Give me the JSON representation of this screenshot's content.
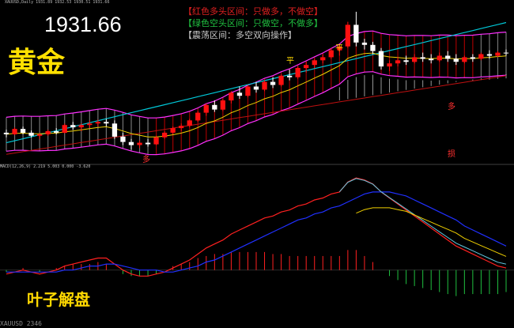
{
  "header": {
    "info": "XAUUSD,Daily  1931.89 1932.53 1930.51 1931.66"
  },
  "price_label": "1931.66",
  "instrument_label": "黄金",
  "legend": {
    "line1": "【红色多头区间：只做多，不做空】",
    "line2": "【绿色空头区间：只做空，不做多】",
    "line3": "【震荡区间：多空双向操作】"
  },
  "annotations": {
    "ping1": "平",
    "ping2": "平",
    "duo1": "多",
    "duo2": "多",
    "sun": "损"
  },
  "macd_label": "MACD(12,26,9) 2.219 5.003 0.000 -3.620",
  "brand": "叶子解盘",
  "status": "XAUUSD 2346",
  "colors": {
    "bull": "#ff1010",
    "bear": "#ffffff",
    "band_fill": "#b00000",
    "band_edge": "#ff30ff",
    "cyan": "#00c8d8",
    "yellow": "#f0d000",
    "macd_fast": "#ff2020",
    "macd_slow": "#2030ff"
  },
  "chart_data": [
    {
      "type": "candlestick",
      "title": "",
      "series": [
        {
          "values": [
            [
              1828,
              1832,
              1822,
              1826
            ],
            [
              1826,
              1835,
              1825,
              1833
            ],
            [
              1833,
              1836,
              1826,
              1828
            ],
            [
              1828,
              1831,
              1822,
              1824
            ],
            [
              1824,
              1828,
              1820,
              1826
            ],
            [
              1826,
              1832,
              1824,
              1830
            ],
            [
              1830,
              1834,
              1826,
              1828
            ],
            [
              1828,
              1840,
              1827,
              1838
            ],
            [
              1838,
              1842,
              1832,
              1835
            ],
            [
              1835,
              1840,
              1830,
              1838
            ],
            [
              1838,
              1844,
              1834,
              1840
            ],
            [
              1840,
              1845,
              1836,
              1842
            ],
            [
              1842,
              1846,
              1836,
              1840
            ],
            [
              1840,
              1844,
              1820,
              1823
            ],
            [
              1823,
              1828,
              1812,
              1816
            ],
            [
              1816,
              1820,
              1806,
              1812
            ],
            [
              1812,
              1818,
              1808,
              1815
            ],
            [
              1815,
              1820,
              1810,
              1813
            ],
            [
              1813,
              1824,
              1812,
              1822
            ],
            [
              1822,
              1830,
              1820,
              1828
            ],
            [
              1828,
              1836,
              1826,
              1834
            ],
            [
              1834,
              1840,
              1830,
              1837
            ],
            [
              1837,
              1846,
              1835,
              1844
            ],
            [
              1844,
              1856,
              1842,
              1854
            ],
            [
              1854,
              1866,
              1850,
              1864
            ],
            [
              1864,
              1870,
              1855,
              1858
            ],
            [
              1858,
              1872,
              1856,
              1870
            ],
            [
              1870,
              1882,
              1866,
              1880
            ],
            [
              1880,
              1888,
              1872,
              1876
            ],
            [
              1876,
              1890,
              1874,
              1888
            ],
            [
              1888,
              1894,
              1880,
              1884
            ],
            [
              1884,
              1896,
              1882,
              1894
            ],
            [
              1894,
              1900,
              1886,
              1890
            ],
            [
              1890,
              1904,
              1888,
              1902
            ],
            [
              1902,
              1910,
              1896,
              1900
            ],
            [
              1900,
              1914,
              1898,
              1912
            ],
            [
              1912,
              1920,
              1906,
              1916
            ],
            [
              1916,
              1924,
              1912,
              1922
            ],
            [
              1922,
              1930,
              1918,
              1926
            ],
            [
              1926,
              1938,
              1924,
              1935
            ],
            [
              1935,
              1942,
              1928,
              1940
            ],
            [
              1940,
              1972,
              1938,
              1968
            ],
            [
              1968,
              1985,
              1940,
              1945
            ],
            [
              1945,
              1950,
              1936,
              1942
            ],
            [
              1942,
              1946,
              1930,
              1934
            ],
            [
              1934,
              1938,
              1910,
              1914
            ],
            [
              1914,
              1922,
              1908,
              1918
            ],
            [
              1918,
              1926,
              1914,
              1922
            ],
            [
              1922,
              1928,
              1916,
              1920
            ],
            [
              1920,
              1930,
              1918,
              1926
            ],
            [
              1926,
              1932,
              1920,
              1924
            ],
            [
              1924,
              1930,
              1918,
              1922
            ],
            [
              1922,
              1932,
              1920,
              1928
            ],
            [
              1928,
              1934,
              1920,
              1924
            ],
            [
              1924,
              1930,
              1916,
              1920
            ],
            [
              1920,
              1928,
              1918,
              1926
            ],
            [
              1926,
              1930,
              1920,
              1924
            ],
            [
              1924,
              1932,
              1922,
              1930
            ],
            [
              1930,
              1935,
              1924,
              1928
            ],
            [
              1928,
              1934,
              1926,
              1932
            ],
            [
              1932,
              1936,
              1928,
              1931
            ]
          ]
        }
      ]
    },
    {
      "type": "line",
      "title": "",
      "series": [
        {
          "values": [
            -2,
            -1,
            0,
            -1,
            -2,
            -1,
            0,
            2,
            3,
            4,
            5,
            6,
            6,
            3,
            0,
            -2,
            -3,
            -3,
            -2,
            -1,
            1,
            3,
            5,
            8,
            11,
            13,
            15,
            18,
            20,
            22,
            24,
            26,
            27,
            29,
            30,
            32,
            33,
            35,
            36,
            38,
            39,
            44,
            46,
            45,
            43,
            39,
            36,
            33,
            30,
            27,
            24,
            21,
            18,
            15,
            12,
            10,
            8,
            6,
            4,
            2,
            1
          ]
        },
        {
          "values": [
            -1,
            -1,
            -1,
            -1,
            -1,
            -1,
            -1,
            0,
            0,
            1,
            2,
            2,
            3,
            3,
            2,
            1,
            0,
            0,
            0,
            -1,
            -1,
            0,
            1,
            2,
            4,
            5,
            7,
            9,
            11,
            13,
            15,
            17,
            19,
            21,
            23,
            25,
            26,
            28,
            29,
            31,
            32,
            34,
            36,
            38,
            39,
            39,
            39,
            38,
            37,
            35,
            33,
            31,
            29,
            27,
            25,
            22,
            20,
            18,
            16,
            14,
            12
          ]
        }
      ],
      "histogram": [
        -1,
        0,
        1,
        0,
        -1,
        0,
        1,
        2,
        3,
        3,
        3,
        4,
        3,
        0,
        -2,
        -3,
        -3,
        -3,
        -2,
        0,
        2,
        3,
        4,
        6,
        7,
        8,
        8,
        9,
        9,
        9,
        9,
        9,
        8,
        8,
        7,
        7,
        7,
        7,
        7,
        7,
        7,
        10,
        10,
        7,
        4,
        0,
        -3,
        -5,
        -7,
        -8,
        -9,
        -10,
        -11,
        -12,
        -13,
        -12,
        -12,
        -12,
        -12,
        -12,
        -11
      ]
    }
  ]
}
